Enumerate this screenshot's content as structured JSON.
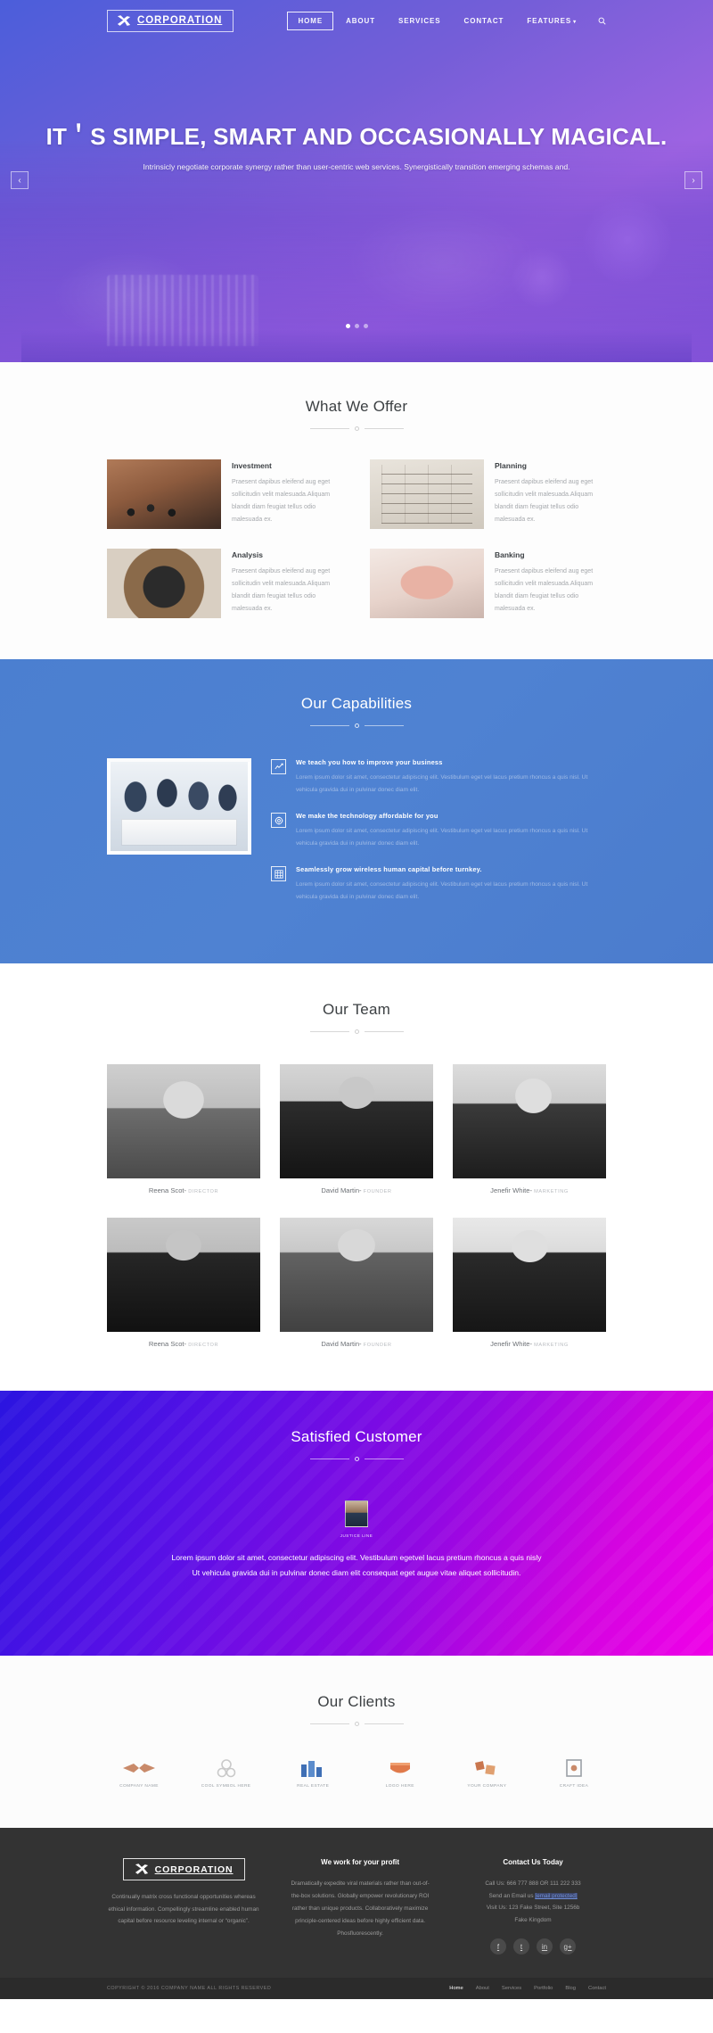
{
  "brand": {
    "name": "CORPORATION",
    "icon": "x-logo-icon"
  },
  "nav": {
    "items": [
      {
        "label": "HOME",
        "active": true
      },
      {
        "label": "ABOUT",
        "active": false
      },
      {
        "label": "SERVICES",
        "active": false
      },
      {
        "label": "CONTACT",
        "active": false
      },
      {
        "label": "FEATURES",
        "active": false,
        "caret": "▾"
      }
    ],
    "search_icon": "search-icon"
  },
  "hero": {
    "title": "IT＇S SIMPLE, SMART AND OCCASIONALLY MAGICAL.",
    "subtitle": "Intrinsicly negotiate corporate synergy rather than user-centric web services. Synergistically transition emerging schemas and.",
    "prev": "‹",
    "next": "›",
    "slides": 3,
    "active_slide": 1
  },
  "offer": {
    "title": "What We Offer",
    "cards": [
      {
        "name": "Investment",
        "desc": "Praesent dapibus eleifend aug eget sollicitudin velit malesuada.Aliquam blandit diam feugiat tellus odio malesuada ex.",
        "thumb": "investment-photo"
      },
      {
        "name": "Planning",
        "desc": "Praesent dapibus eleifend aug eget sollicitudin velit malesuada.Aliquam blandit diam feugiat tellus odio malesuada ex.",
        "thumb": "planning-photo"
      },
      {
        "name": "Analysis",
        "desc": "Praesent dapibus eleifend aug eget sollicitudin velit malesuada.Aliquam blandit diam feugiat tellus odio malesuada ex.",
        "thumb": "analysis-photo"
      },
      {
        "name": "Banking",
        "desc": "Praesent dapibus eleifend aug eget sollicitudin velit malesuada.Aliquam blandit diam feugiat tellus odio malesuada ex.",
        "thumb": "banking-photo"
      }
    ]
  },
  "capabilities": {
    "title": "Our Capabilities",
    "photo": "team-meeting-photo",
    "items": [
      {
        "icon": "chart-line-icon",
        "heading": "We teach you how to improve your business",
        "body": "Lorem ipsum dolor sit amet, consectetur adipiscing elit. Vestibulum eget vel lacus pretium rhoncus a quis nisl. Ut vehicula gravida dui in pulvinar donec diam elit."
      },
      {
        "icon": "target-globe-icon",
        "heading": "We make the technology affordable for you",
        "body": "Lorem ipsum dolor sit amet, consectetur adipiscing elit. Vestibulum eget vel lacus pretium rhoncus a quis nisl. Ut vehicula gravida dui in pulvinar donec diam elit."
      },
      {
        "icon": "grid-icon",
        "heading": "Seamlessly grow wireless human capital before turnkey.",
        "body": "Lorem ipsum dolor sit amet, consectetur adipiscing elit. Vestibulum eget vel lacus pretium rhoncus a quis nisl. Ut vehicula gravida dui in pulvinar donec diam elit."
      }
    ]
  },
  "team": {
    "title": "Our Team",
    "members": [
      {
        "name": "Reena Scot",
        "role": "DIRECTOR",
        "photo": "member-photo-1"
      },
      {
        "name": "David Martin",
        "role": "FOUNDER",
        "photo": "member-photo-2"
      },
      {
        "name": "Jenefir White",
        "role": "MARKETING",
        "photo": "member-photo-3"
      },
      {
        "name": "Reena Scot",
        "role": "DIRECTOR",
        "photo": "member-photo-4"
      },
      {
        "name": "David Martin",
        "role": "FOUNDER",
        "photo": "member-photo-5"
      },
      {
        "name": "Jenefir White",
        "role": "MARKETING",
        "photo": "member-photo-6"
      }
    ],
    "separator": "-"
  },
  "testimonial": {
    "title": "Satisfied Customer",
    "avatar": "customer-avatar",
    "customer_name": "JUSTICE LINE",
    "quote": "Lorem ipsum dolor sit amet, consectetur adipiscing elit. Vestibulum egetvel lacus pretium rhoncus a quis nisly Ut vehicula gravida dui in pulvinar donec diam elit consequat eget augue vitae aliquet sollicitudin.",
    "prev": "‹",
    "next": "›"
  },
  "clients": {
    "title": "Our Clients",
    "logos": [
      {
        "name": "company name",
        "mark": "wings-logo-icon"
      },
      {
        "name": "Cool Symbol Here",
        "mark": "atom-logo-icon"
      },
      {
        "name": "Real Estate",
        "mark": "buildings-logo-icon"
      },
      {
        "name": "LOGO HERE",
        "mark": "shield-logo-icon"
      },
      {
        "name": "YOUR COMPANY",
        "mark": "cubes-logo-icon"
      },
      {
        "name": "CRAFT IDEA",
        "mark": "frame-logo-icon"
      }
    ]
  },
  "footer": {
    "brand_name": "CORPORATION",
    "about": "Continually matrix cross functional opportunities whereas ethical information. Compellingly streamline enabled human capital before resource leveling internal or “organic”.",
    "col2_title": "We work for your profit",
    "col2_text": "Dramatically expedite viral materials rather than out-of-the-box solutions. Globally empower revolutionary ROI rather than unique products. Collaboratively maximize principle-centered ideas before highly efficient data. Phosfluorescently.",
    "col3_title": "Contact Us Today",
    "contact_call": "Call Us: 666 777 888 OR 111 222 333",
    "contact_email_pre": "Send an Email us ",
    "contact_email": "[email protected]",
    "contact_address1": "Visit Us: 123 Fake Street, Site 1256b",
    "contact_address2": "Fake Kingdom",
    "social": [
      {
        "name": "facebook-icon",
        "glyph": "f"
      },
      {
        "name": "twitter-icon",
        "glyph": "t"
      },
      {
        "name": "linkedin-icon",
        "glyph": "in"
      },
      {
        "name": "google-plus-icon",
        "glyph": "g+"
      }
    ]
  },
  "copybar": {
    "text": "COPYRIGHT © 2016 COMPANY NAME ALL RIGHTS RESERVED",
    "links": [
      {
        "label": "Home",
        "active": true
      },
      {
        "label": "About",
        "active": false
      },
      {
        "label": "Services",
        "active": false
      },
      {
        "label": "Portfolio",
        "active": false
      },
      {
        "label": "Blog",
        "active": false
      },
      {
        "label": "Contact",
        "active": false
      }
    ]
  },
  "colors": {
    "hero_blue": "#3f54cf",
    "capability_blue": "#4b7fd0",
    "testimonial_from": "#2a14e0",
    "testimonial_to": "#f000e8",
    "footer_dark": "#333333"
  }
}
